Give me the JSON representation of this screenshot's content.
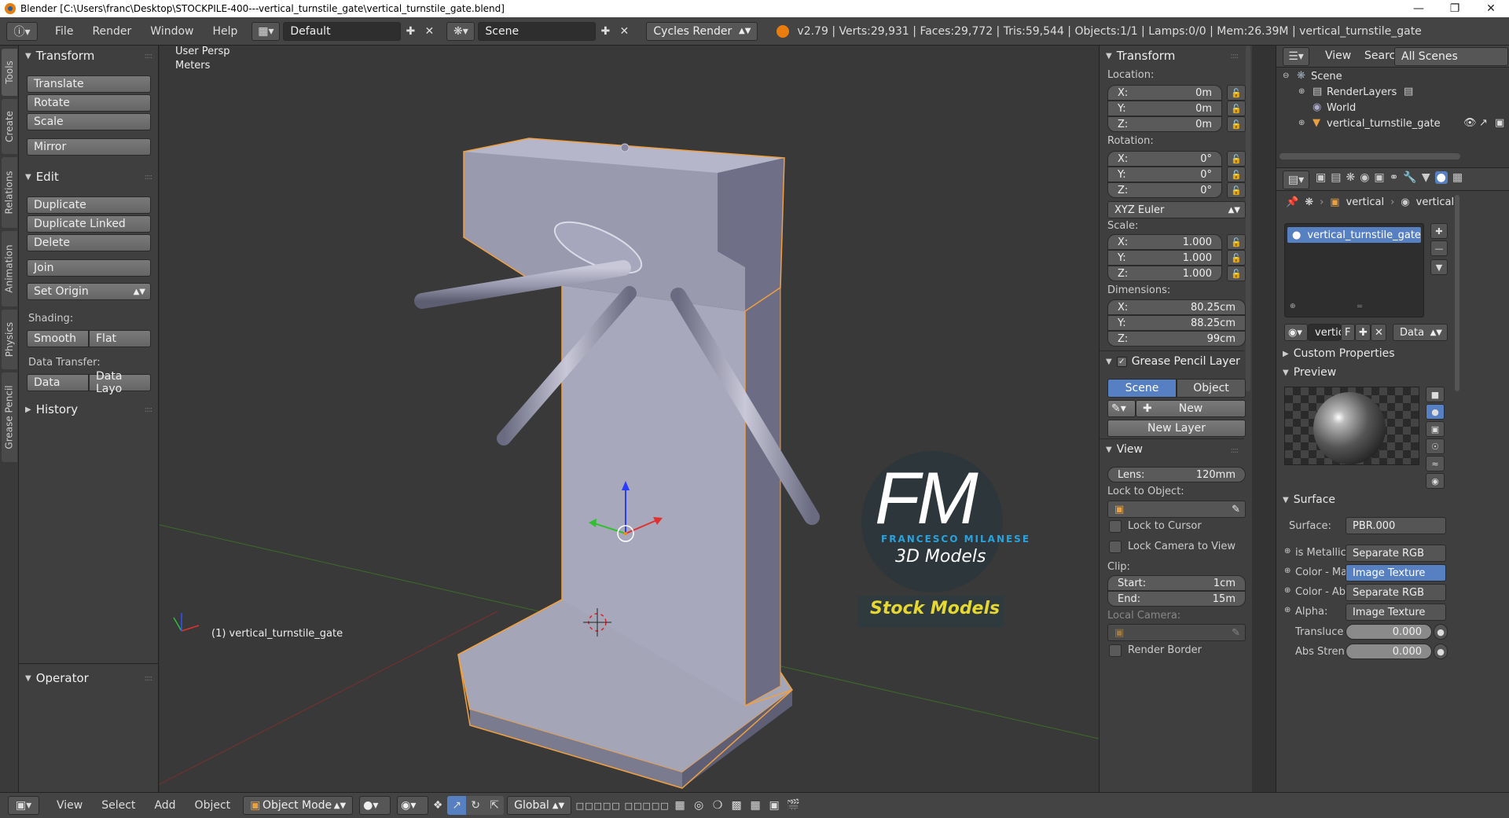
{
  "titlebar": {
    "title": "Blender [C:\\Users\\franc\\Desktop\\STOCKPILE-400---vertical_turnstile_gate\\vertical_turnstile_gate.blend]"
  },
  "menubar": {
    "items": [
      "File",
      "Render",
      "Window",
      "Help"
    ],
    "layout": "Default",
    "scene": "Scene",
    "engine": "Cycles Render",
    "stats": "v2.79 | Verts:29,931 | Faces:29,772 | Tris:59,544 | Objects:1/1 | Lamps:0/0 | Mem:26.39M | vertical_turnstile_gate"
  },
  "tabs": [
    "Tools",
    "Create",
    "Relations",
    "Animation",
    "Physics",
    "Grease Pencil"
  ],
  "toolshelf": {
    "transform_header": "Transform",
    "translate": "Translate",
    "rotate": "Rotate",
    "scale": "Scale",
    "mirror": "Mirror",
    "edit_header": "Edit",
    "duplicate": "Duplicate",
    "duplicate_linked": "Duplicate Linked",
    "delete": "Delete",
    "join": "Join",
    "set_origin": "Set Origin",
    "shading_label": "Shading:",
    "smooth": "Smooth",
    "flat": "Flat",
    "data_transfer_label": "Data Transfer:",
    "data": "Data",
    "data_layo": "Data Layo",
    "history_header": "History",
    "operator_header": "Operator"
  },
  "viewport": {
    "view_name": "User Persp",
    "units": "Meters",
    "object_label": "(1) vertical_turnstile_gate",
    "watermark_fm": "FM",
    "watermark_name": "FRANCESCO MILANESE",
    "watermark_3d": "3D Models",
    "watermark_stock": "Stock Models"
  },
  "npanel": {
    "transform_header": "Transform",
    "location_label": "Location:",
    "loc": [
      {
        "axis": "X:",
        "value": "0m"
      },
      {
        "axis": "Y:",
        "value": "0m"
      },
      {
        "axis": "Z:",
        "value": "0m"
      }
    ],
    "rotation_label": "Rotation:",
    "rot": [
      {
        "axis": "X:",
        "value": "0°"
      },
      {
        "axis": "Y:",
        "value": "0°"
      },
      {
        "axis": "Z:",
        "value": "0°"
      }
    ],
    "rotation_mode": "XYZ Euler",
    "scale_label": "Scale:",
    "scl": [
      {
        "axis": "X:",
        "value": "1.000"
      },
      {
        "axis": "Y:",
        "value": "1.000"
      },
      {
        "axis": "Z:",
        "value": "1.000"
      }
    ],
    "dimensions_label": "Dimensions:",
    "dim": [
      {
        "axis": "X:",
        "value": "80.25cm"
      },
      {
        "axis": "Y:",
        "value": "88.25cm"
      },
      {
        "axis": "Z:",
        "value": "99cm"
      }
    ],
    "gp_header": "Grease Pencil Layer",
    "gp_scene": "Scene",
    "gp_object": "Object",
    "gp_new": "New",
    "gp_new_layer": "New Layer",
    "view_header": "View",
    "lens_label": "Lens:",
    "lens_value": "120mm",
    "lock_to_object": "Lock to Object:",
    "lock_to_cursor": "Lock to Cursor",
    "lock_camera": "Lock Camera to View",
    "clip_label": "Clip:",
    "clip_start_label": "Start:",
    "clip_start": "1cm",
    "clip_end_label": "End:",
    "clip_end": "15m",
    "local_camera": "Local Camera:",
    "render_border": "Render Border"
  },
  "outliner": {
    "view": "View",
    "search": "Search",
    "all_scenes": "All Scenes",
    "scene": "Scene",
    "renderlayers": "RenderLayers",
    "world": "World",
    "object": "vertical_turnstile_gate"
  },
  "properties": {
    "crumb1": "vertical",
    "crumb2": "vertical",
    "material_slot": "vertical_turnstile_gate",
    "mat_name": "vertic",
    "mat_f": "F",
    "mat_data": "Data",
    "custom_props": "Custom Properties",
    "preview": "Preview",
    "surface_header": "Surface",
    "surface_label": "Surface:",
    "surface_value": "PBR.000",
    "rows": [
      {
        "label": "is Metallic",
        "value": "Separate RGB"
      },
      {
        "label": "Color - Ma",
        "value": "Image Texture"
      },
      {
        "label": "Color - Ab",
        "value": "Separate RGB"
      },
      {
        "label": "Alpha:",
        "value": "Image Texture"
      }
    ],
    "translucence_label": "Transluce",
    "translucence_value": "0.000",
    "abs_label": "Abs Stren",
    "abs_value": "0.000"
  },
  "bottombar": {
    "view": "View",
    "select": "Select",
    "add": "Add",
    "object": "Object",
    "mode": "Object Mode",
    "orientation": "Global"
  },
  "colors": {
    "selected_blue": "#5680c2",
    "object_outline": "#f0a040",
    "watermark_blue": "#29a3dd",
    "watermark_yellow": "#e6d830"
  }
}
